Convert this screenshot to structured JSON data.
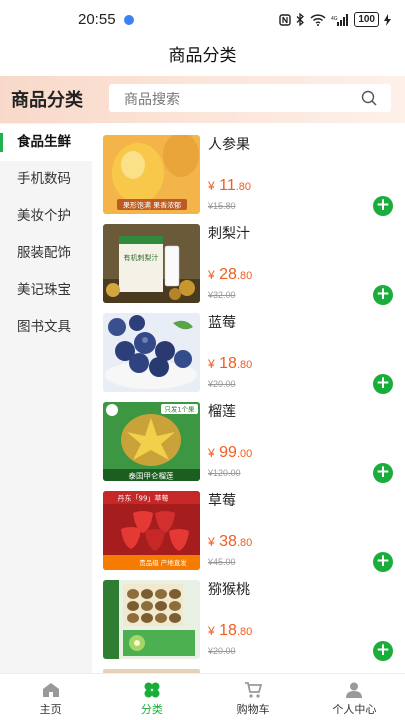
{
  "status_bar": {
    "time": "20:55",
    "battery": "100",
    "signal_label": "4G"
  },
  "nav": {
    "title": "商品分类"
  },
  "header": {
    "title": "商品分类",
    "search_placeholder": "商品搜索"
  },
  "sidebar": {
    "items": [
      {
        "label": "食品生鲜",
        "active": true
      },
      {
        "label": "手机数码",
        "active": false
      },
      {
        "label": "美妆个护",
        "active": false
      },
      {
        "label": "服装配饰",
        "active": false
      },
      {
        "label": "美记珠宝",
        "active": false
      },
      {
        "label": "图书文具",
        "active": false
      }
    ]
  },
  "products": [
    {
      "name": "人参果",
      "currency": "¥",
      "price_int": "11",
      "price_dec": ".80",
      "original": "¥15.80",
      "thumb_caption": "果形饱满 果香浓郁"
    },
    {
      "name": "刺梨汁",
      "currency": "¥",
      "price_int": "28",
      "price_dec": ".80",
      "original": "¥32.00",
      "thumb_caption": "有机刺梨汁"
    },
    {
      "name": "蓝莓",
      "currency": "¥",
      "price_int": "18",
      "price_dec": ".80",
      "original": "¥20.00",
      "thumb_caption": ""
    },
    {
      "name": "榴莲",
      "currency": "¥",
      "price_int": "99",
      "price_dec": ".00",
      "original": "¥120.00",
      "thumb_caption": "泰国甲仑榴莲",
      "thumb_badge": "只发1个果"
    },
    {
      "name": "草莓",
      "currency": "¥",
      "price_int": "38",
      "price_dec": ".80",
      "original": "¥45.00",
      "thumb_caption": "丹东「99」草莓",
      "thumb_badge": "贵品级 产地直发"
    },
    {
      "name": "猕猴桃",
      "currency": "¥",
      "price_int": "18",
      "price_dec": ".80",
      "original": "¥20.00",
      "thumb_caption": ""
    }
  ],
  "add_button_label": "+",
  "tabbar": {
    "items": [
      {
        "label": "主页",
        "active": false
      },
      {
        "label": "分类",
        "active": true
      },
      {
        "label": "购物车",
        "active": false
      },
      {
        "label": "个人中心",
        "active": false
      }
    ]
  },
  "colors": {
    "accent": "#1aad3c",
    "price": "#f25c1e",
    "header_band": "#f8d9c9"
  }
}
